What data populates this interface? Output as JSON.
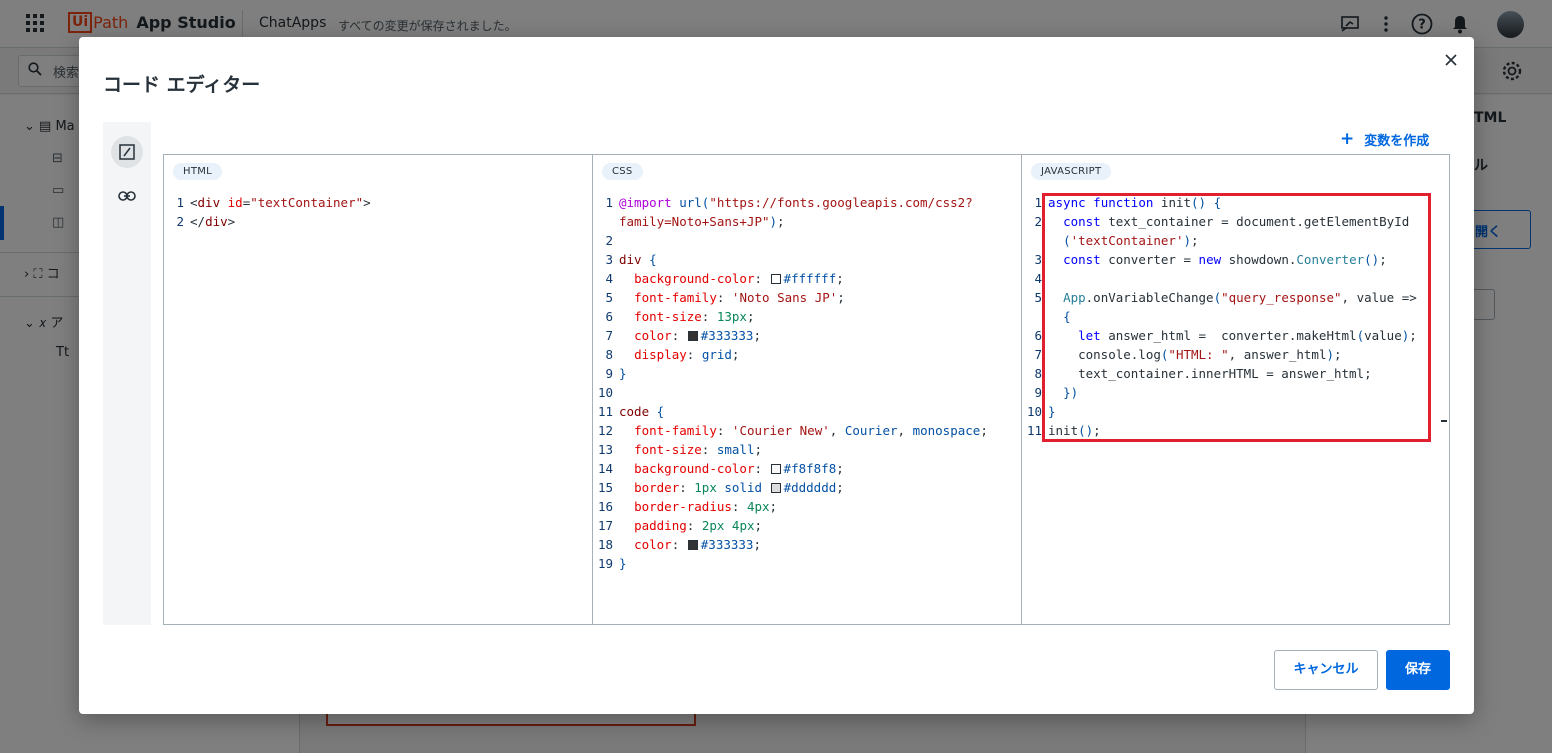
{
  "app": {
    "brand_ui": "Ui",
    "brand_path": "Path",
    "product": "App Studio",
    "app_name": "ChatApps",
    "save_status": "すべての変更が保存されました。"
  },
  "background": {
    "search_placeholder": "検索",
    "left_panel": {
      "main_item": "Ma",
      "components_item": "コ",
      "variables_item": "ア",
      "text_item": "Tt"
    },
    "right_panel": {
      "html_title": "TML",
      "heading": "ル",
      "open_button": "開く"
    }
  },
  "modal": {
    "title": "コード エディター",
    "create_variable_label": "変数を作成",
    "cancel_label": "キャンセル",
    "save_label": "保存",
    "panes": {
      "html_label": "HTML",
      "css_label": "CSS",
      "js_label": "JAVASCRIPT"
    }
  },
  "icons": {
    "apps_grid": "apps-grid-icon",
    "close": "close-icon",
    "code": "code-icon",
    "link": "link-icon",
    "plus": "plus-icon",
    "settings": "gear-icon",
    "search": "search-icon"
  },
  "code": {
    "html": [
      {
        "n": "1",
        "parts": [
          [
            "t",
            "<"
          ],
          [
            "tag",
            "div"
          ],
          [
            "t",
            " "
          ],
          [
            "attr",
            "id"
          ],
          [
            "t",
            "="
          ],
          [
            "str",
            "\"textContainer\""
          ],
          [
            "t",
            ">"
          ]
        ]
      },
      {
        "n": "2",
        "parts": [
          [
            "t",
            "</"
          ],
          [
            "tag",
            "div"
          ],
          [
            "t",
            ">"
          ]
        ]
      }
    ],
    "css": [
      {
        "n": "1",
        "parts": [
          [
            "at",
            "@import"
          ],
          [
            "t",
            " "
          ],
          [
            "val",
            "url("
          ],
          [
            "str",
            "\"https://fonts.googleapis.com/css2?"
          ]
        ]
      },
      {
        "n": "",
        "parts": [
          [
            "str",
            "family=Noto+Sans+JP\""
          ],
          [
            "val",
            ")"
          ],
          [
            "t",
            ";"
          ]
        ]
      },
      {
        "n": "2",
        "parts": []
      },
      {
        "n": "3",
        "parts": [
          [
            "tag",
            "div"
          ],
          [
            "t",
            " "
          ],
          [
            "brace",
            "{"
          ]
        ]
      },
      {
        "n": "4",
        "parts": [
          [
            "t",
            "  "
          ],
          [
            "prop",
            "background-color"
          ],
          [
            "t",
            ": "
          ],
          [
            "swatch",
            "#ffffff"
          ],
          [
            "val",
            "#ffffff"
          ],
          [
            "t",
            ";"
          ]
        ]
      },
      {
        "n": "5",
        "parts": [
          [
            "t",
            "  "
          ],
          [
            "prop",
            "font-family"
          ],
          [
            "t",
            ": "
          ],
          [
            "str",
            "'Noto Sans JP'"
          ],
          [
            "t",
            ";"
          ]
        ]
      },
      {
        "n": "6",
        "parts": [
          [
            "t",
            "  "
          ],
          [
            "prop",
            "font-size"
          ],
          [
            "t",
            ": "
          ],
          [
            "num",
            "13px"
          ],
          [
            "t",
            ";"
          ]
        ]
      },
      {
        "n": "7",
        "parts": [
          [
            "t",
            "  "
          ],
          [
            "prop",
            "color"
          ],
          [
            "t",
            ": "
          ],
          [
            "swatch",
            "#333333"
          ],
          [
            "val",
            "#333333"
          ],
          [
            "t",
            ";"
          ]
        ]
      },
      {
        "n": "8",
        "parts": [
          [
            "t",
            "  "
          ],
          [
            "prop",
            "display"
          ],
          [
            "t",
            ": "
          ],
          [
            "val",
            "grid"
          ],
          [
            "t",
            ";"
          ]
        ]
      },
      {
        "n": "9",
        "parts": [
          [
            "brace",
            "}"
          ]
        ]
      },
      {
        "n": "10",
        "parts": []
      },
      {
        "n": "11",
        "parts": [
          [
            "tag",
            "code"
          ],
          [
            "t",
            " "
          ],
          [
            "brace",
            "{"
          ]
        ]
      },
      {
        "n": "12",
        "parts": [
          [
            "t",
            "  "
          ],
          [
            "prop",
            "font-family"
          ],
          [
            "t",
            ": "
          ],
          [
            "str",
            "'Courier New'"
          ],
          [
            "t",
            ", "
          ],
          [
            "val",
            "Courier"
          ],
          [
            "t",
            ", "
          ],
          [
            "val",
            "monospace"
          ],
          [
            "t",
            ";"
          ]
        ]
      },
      {
        "n": "13",
        "parts": [
          [
            "t",
            "  "
          ],
          [
            "prop",
            "font-size"
          ],
          [
            "t",
            ": "
          ],
          [
            "val",
            "small"
          ],
          [
            "t",
            ";"
          ]
        ]
      },
      {
        "n": "14",
        "parts": [
          [
            "t",
            "  "
          ],
          [
            "prop",
            "background-color"
          ],
          [
            "t",
            ": "
          ],
          [
            "swatch",
            "#f8f8f8"
          ],
          [
            "val",
            "#f8f8f8"
          ],
          [
            "t",
            ";"
          ]
        ]
      },
      {
        "n": "15",
        "parts": [
          [
            "t",
            "  "
          ],
          [
            "prop",
            "border"
          ],
          [
            "t",
            ": "
          ],
          [
            "num",
            "1px"
          ],
          [
            "t",
            " "
          ],
          [
            "val",
            "solid"
          ],
          [
            "t",
            " "
          ],
          [
            "swatch",
            "#dddddd"
          ],
          [
            "val",
            "#dddddd"
          ],
          [
            "t",
            ";"
          ]
        ]
      },
      {
        "n": "16",
        "parts": [
          [
            "t",
            "  "
          ],
          [
            "prop",
            "border-radius"
          ],
          [
            "t",
            ": "
          ],
          [
            "num",
            "4px"
          ],
          [
            "t",
            ";"
          ]
        ]
      },
      {
        "n": "17",
        "parts": [
          [
            "t",
            "  "
          ],
          [
            "prop",
            "padding"
          ],
          [
            "t",
            ": "
          ],
          [
            "num",
            "2px"
          ],
          [
            "t",
            " "
          ],
          [
            "num",
            "4px"
          ],
          [
            "t",
            ";"
          ]
        ]
      },
      {
        "n": "18",
        "parts": [
          [
            "t",
            "  "
          ],
          [
            "prop",
            "color"
          ],
          [
            "t",
            ": "
          ],
          [
            "swatch",
            "#333333"
          ],
          [
            "val",
            "#333333"
          ],
          [
            "t",
            ";"
          ]
        ]
      },
      {
        "n": "19",
        "parts": [
          [
            "brace",
            "}"
          ]
        ]
      }
    ],
    "js": [
      {
        "n": "1",
        "parts": [
          [
            "kw",
            "async"
          ],
          [
            "t",
            " "
          ],
          [
            "kw",
            "function"
          ],
          [
            "t",
            " "
          ],
          [
            "func",
            "init"
          ],
          [
            "brace",
            "()"
          ],
          [
            "t",
            " "
          ],
          [
            "brace",
            "{"
          ]
        ]
      },
      {
        "n": "2",
        "parts": [
          [
            "t",
            "  "
          ],
          [
            "kw",
            "const"
          ],
          [
            "t",
            " text_container = document.getElementById"
          ]
        ]
      },
      {
        "n": "",
        "parts": [
          [
            "t",
            "  "
          ],
          [
            "brace",
            "("
          ],
          [
            "str",
            "'textContainer'"
          ],
          [
            "brace",
            ")"
          ],
          [
            "t",
            ";"
          ]
        ]
      },
      {
        "n": "3",
        "parts": [
          [
            "t",
            "  "
          ],
          [
            "kw",
            "const"
          ],
          [
            "t",
            " converter = "
          ],
          [
            "kw",
            "new"
          ],
          [
            "t",
            " showdown."
          ],
          [
            "obj",
            "Converter"
          ],
          [
            "brace",
            "()"
          ],
          [
            "t",
            ";"
          ]
        ]
      },
      {
        "n": "4",
        "parts": []
      },
      {
        "n": "5",
        "parts": [
          [
            "t",
            "  "
          ],
          [
            "obj",
            "App"
          ],
          [
            "t",
            ".onVariableChange"
          ],
          [
            "brace",
            "("
          ],
          [
            "str",
            "\"query_response\""
          ],
          [
            "t",
            ", value =>"
          ]
        ]
      },
      {
        "n": "",
        "parts": [
          [
            "t",
            "  "
          ],
          [
            "brace",
            "{"
          ]
        ]
      },
      {
        "n": "6",
        "parts": [
          [
            "t",
            "    "
          ],
          [
            "kw",
            "let"
          ],
          [
            "t",
            " answer_html =  converter.makeHtml"
          ],
          [
            "brace",
            "("
          ],
          [
            "t",
            "value"
          ],
          [
            "brace",
            ")"
          ],
          [
            "t",
            ";"
          ]
        ]
      },
      {
        "n": "7",
        "parts": [
          [
            "t",
            "    console.log"
          ],
          [
            "brace",
            "("
          ],
          [
            "str",
            "\"HTML: \""
          ],
          [
            "t",
            ", answer_html"
          ],
          [
            "brace",
            ")"
          ],
          [
            "t",
            ";"
          ]
        ]
      },
      {
        "n": "8",
        "parts": [
          [
            "t",
            "    text_container.innerHTML = answer_html;"
          ]
        ]
      },
      {
        "n": "9",
        "parts": [
          [
            "t",
            "  "
          ],
          [
            "brace",
            "})"
          ]
        ]
      },
      {
        "n": "10",
        "parts": [
          [
            "brace",
            "}"
          ]
        ]
      },
      {
        "n": "11",
        "parts": [
          [
            "t",
            "init"
          ],
          [
            "brace",
            "()"
          ],
          [
            "t",
            ";"
          ]
        ]
      }
    ]
  }
}
